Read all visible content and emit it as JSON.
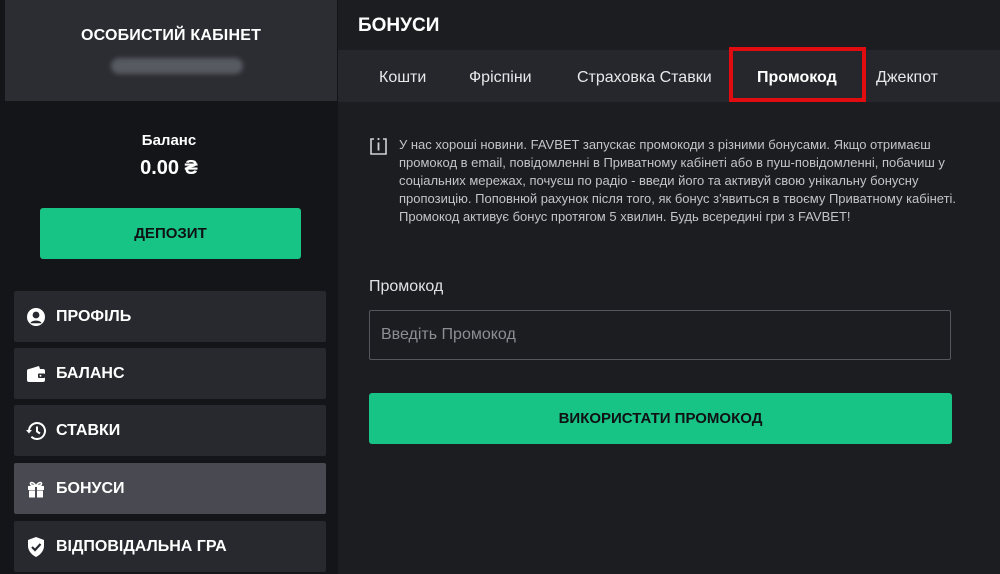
{
  "sidebar": {
    "title": "ОСОБИСТИЙ КАБІНЕТ",
    "balance_label": "Баланс",
    "balance_value": "0.00 ₴",
    "deposit_label": "ДЕПОЗИТ",
    "items": [
      {
        "label": "ПРОФІЛЬ",
        "icon": "profile-icon"
      },
      {
        "label": "БАЛАНС",
        "icon": "wallet-icon"
      },
      {
        "label": "СТАВКИ",
        "icon": "history-icon"
      },
      {
        "label": "БОНУСИ",
        "icon": "gift-icon",
        "active": true
      },
      {
        "label": "ВІДПОВІДАЛЬНА ГРА",
        "icon": "shield-icon"
      }
    ]
  },
  "main": {
    "title": "БОНУСИ",
    "tabs": [
      {
        "label": "Кошти"
      },
      {
        "label": "Фріспіни"
      },
      {
        "label": "Страховка Ставки"
      },
      {
        "label": "Промокод",
        "active": true
      },
      {
        "label": "Джекпот"
      }
    ],
    "info_icon": "info-icon",
    "info_text": "У нас хороші новини. FAVBET запускає промокоди з різними бонусами. Якщо отримаєш промокод в email, повідомленні в Приватному кабінеті або в пуш-повідомленні, побачиш у соціальних мережах, почуєш по радіо - введи його та активуй свою унікальну бонусну пропозицію. Поповнюй рахунок після того, як бонус з'явиться в твоєму Приватному кабінеті. Промокод активує бонус протягом 5 хвилин. Будь всередині гри з FAVBET!",
    "promo_label": "Промокод",
    "promo_placeholder": "Введіть Промокод",
    "promo_value": "",
    "use_button_label": "ВИКОРИСТАТИ ПРОМОКОД"
  },
  "colors": {
    "accent": "#18c386",
    "highlight": "#e10c10",
    "sidebar_header": "#2c2d33",
    "nav_item": "#28292e",
    "nav_item_active": "#494a51",
    "background": "#1c1d21"
  }
}
